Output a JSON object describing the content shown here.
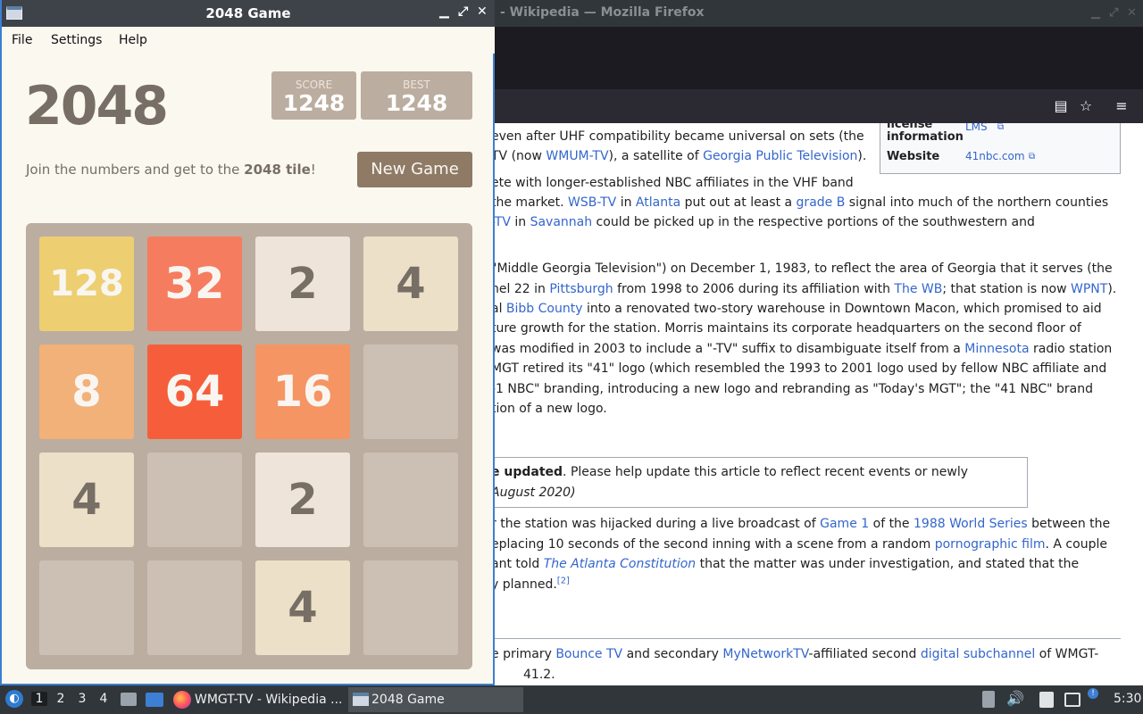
{
  "firefox": {
    "title": "- Wikipedia — Mozilla Firefox",
    "infobox": {
      "row1_key": "license information",
      "row1_key_a": "license",
      "row1_key_b": "information",
      "row1_value": "LMS",
      "row2_key": "Website",
      "row2_value": "41nbc.com"
    },
    "lines": {
      "l1": "even after UHF compatibility became universal on sets (the",
      "l2a": "TV (now ",
      "l2b": "WMUM-TV",
      "l2c": "), a satellite of ",
      "l2d": "Georgia Public Television",
      "l2e": ").",
      "l3": "ete with longer-established NBC affiliates in the VHF band",
      "l4a": "the market. ",
      "l4b": "WSB-TV",
      "l4c": " in ",
      "l4d": "Atlanta",
      "l4e": " put out at least a ",
      "l4f": "grade B",
      "l4g": " signal into much of the northern counties",
      "l5a": "-TV",
      "l5b": " in ",
      "l5c": "Savannah",
      "l5d": " could be picked up in the respective portions of the southwestern and",
      "l6": "\"Middle Georgia Television\") on December 1, 1983, to reflect the area of Georgia that it serves (the",
      "l7a": "nel 22 in ",
      "l7b": "Pittsburgh",
      "l7c": " from 1998 to 2006 during its affiliation with ",
      "l7d": "The WB",
      "l7e": "; that station is now ",
      "l7f": "WPNT",
      "l7g": ").",
      "l8a": "al ",
      "l8b": "Bibb County",
      "l8c": " into a renovated two-story warehouse in Downtown Macon, which promised to aid",
      "l9": "ture growth for the station. Morris maintains its corporate headquarters on the second floor of",
      "l10a": "was modified in 2003 to include a \"-TV\" suffix to disambiguate itself from a ",
      "l10b": "Minnesota",
      "l10c": " radio station",
      "l11": "MGT retired its \"41\" logo (which resembled the 1993 to 2001 logo used by fellow NBC affiliate and",
      "l12": "-1 NBC\" branding, introducing a new logo and rebranding as \"Today's MGT\"; the \"41 NBC\" brand",
      "l13": "tion of a new logo.",
      "n1a": "e updated",
      "n1b": ". Please help update this article to reflect recent events or newly",
      "n2": "August 2020)",
      "l14a": "r the station was hijacked during a live broadcast of ",
      "l14b": "Game 1",
      "l14c": " of the ",
      "l14d": "1988 World Series",
      "l14e": " between the",
      "l15a": "eplacing 10 seconds of the second inning with a scene from a random ",
      "l15b": "pornographic film",
      "l15c": ". A couple",
      "l16a": "ant told ",
      "l16b": "The Atlanta Constitution",
      "l16c": " that the matter was under investigation, and stated that the",
      "l17a": "y planned.",
      "l17b": "[2]",
      "l18a": "e primary ",
      "l18b": "Bounce TV",
      "l18c": " and secondary ",
      "l18d": "MyNetworkTV",
      "l18e": "-affiliated second ",
      "l18f": "digital subchannel",
      "l18g": " of WMGT-",
      "l19": "41.2."
    }
  },
  "game": {
    "window_title": "2048 Game",
    "menu": [
      "File",
      "Settings",
      "Help"
    ],
    "heading": "2048",
    "score_label": "SCORE",
    "score": "1248",
    "best_label": "BEST",
    "best": "1248",
    "intro_a": "Join the numbers and get to the ",
    "intro_b": "2048 tile",
    "intro_c": "!",
    "new_game": "New Game",
    "grid": [
      [
        "128",
        "32",
        "2",
        "4"
      ],
      [
        "8",
        "64",
        "16",
        ""
      ],
      [
        "4",
        "",
        "2",
        ""
      ],
      [
        "",
        "",
        "4",
        ""
      ]
    ],
    "tile_colors": {
      "2": {
        "bg": "#eee4da",
        "fg": "#776e65"
      },
      "4": {
        "bg": "#ede0c8",
        "fg": "#776e65"
      },
      "8": {
        "bg": "#f2b179",
        "fg": "#f9f6f2"
      },
      "16": {
        "bg": "#f59563",
        "fg": "#f9f6f2"
      },
      "32": {
        "bg": "#f67c5f",
        "fg": "#f9f6f2"
      },
      "64": {
        "bg": "#f65e3b",
        "fg": "#f9f6f2"
      },
      "128": {
        "bg": "#edcf72",
        "fg": "#f9f6f2"
      }
    }
  },
  "taskbar": {
    "workspaces": [
      "1",
      "2",
      "3",
      "4"
    ],
    "task1": "WMGT-TV - Wikipedia ...",
    "task2": "2048 Game",
    "clock": "5:30"
  }
}
